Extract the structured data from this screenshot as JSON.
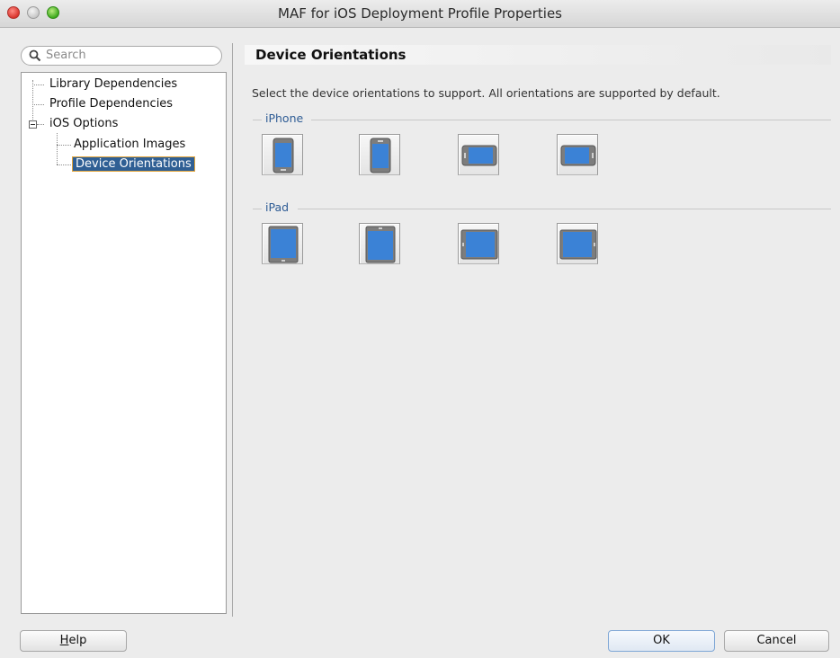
{
  "window": {
    "title": "MAF for iOS Deployment Profile Properties"
  },
  "search": {
    "placeholder": "Search"
  },
  "tree": {
    "items": [
      {
        "label": "Library Dependencies"
      },
      {
        "label": "Profile Dependencies"
      },
      {
        "label": "iOS Options",
        "expanded": true
      },
      {
        "label": "Application Images"
      },
      {
        "label": "Device Orientations",
        "selected": true
      }
    ]
  },
  "panel": {
    "title": "Device Orientations",
    "description": "Select the device orientations to support. All orientations are supported by default."
  },
  "groups": [
    {
      "label": "iPhone",
      "orientations": [
        "Portrait",
        "Portrait Upside Down",
        "Landscape Left",
        "Landscape Right"
      ]
    },
    {
      "label": "iPad",
      "orientations": [
        "Portrait",
        "Portrait Upside Down",
        "Landscape Left",
        "Landscape Right"
      ]
    }
  ],
  "buttons": {
    "help_mnemonic": "H",
    "help_rest": "elp",
    "ok": "OK",
    "cancel": "Cancel"
  },
  "colors": {
    "selection": "#2f5f94",
    "group_label": "#2e5c95",
    "screen": "#3b82d6"
  }
}
